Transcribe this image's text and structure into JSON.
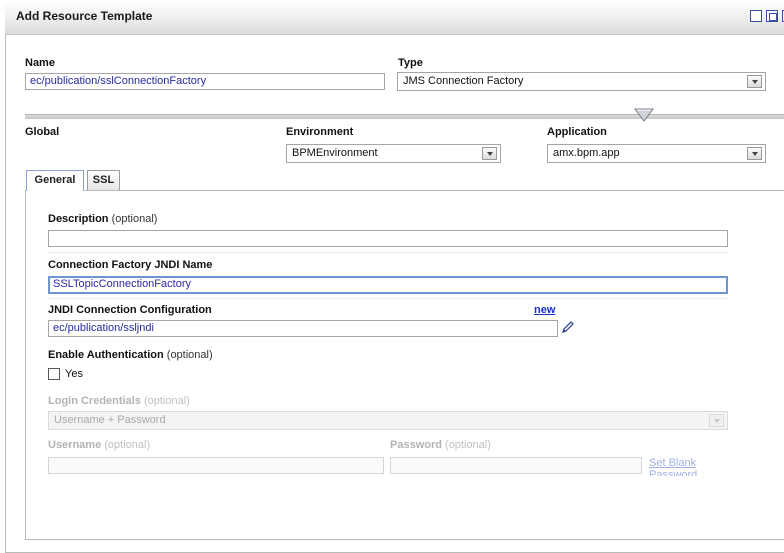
{
  "window": {
    "title": "Add Resource Template",
    "buttons": [
      "minimize-button",
      "maximize-button"
    ]
  },
  "name_field": {
    "label": "Name",
    "value": "ec/publication/sslConnectionFactory"
  },
  "type_field": {
    "label": "Type",
    "value": "JMS Connection Factory"
  },
  "scope": {
    "global_label": "Global",
    "environment": {
      "label": "Environment",
      "value": "BPMEnvironment"
    },
    "application": {
      "label": "Application",
      "value": "amx.bpm.app"
    }
  },
  "tabs": [
    {
      "label": "General",
      "active": true
    },
    {
      "label": "SSL",
      "active": false
    }
  ],
  "general": {
    "description": {
      "label": "Description",
      "optional": "(optional)",
      "value": ""
    },
    "jndi_name": {
      "label": "Connection Factory JNDI Name",
      "value": "SSLTopicConnectionFactory"
    },
    "jndi_config": {
      "label": "JNDI Connection Configuration",
      "value": "ec/publication/ssljndi",
      "new_link": "new"
    },
    "enable_auth": {
      "label": "Enable Authentication",
      "optional": "(optional)",
      "checkbox_label": "Yes",
      "checked": false
    },
    "login_credentials": {
      "label": "Login Credentials",
      "optional": "(optional)",
      "value": "Username + Password"
    },
    "username": {
      "label": "Username",
      "optional": "(optional)",
      "value": ""
    },
    "password": {
      "label": "Password",
      "optional": "(optional)",
      "value": "",
      "set_blank_link": "Set Blank Password"
    }
  },
  "colors": {
    "accent_link": "#1b31c2",
    "value_text": "#2a2aa0",
    "focus_border": "#6f95d2",
    "window_button": "#3a4fa3"
  },
  "icons": [
    "pencil-edit-icon",
    "slider-thumb-icon",
    "dropdown-arrow-icon"
  ]
}
